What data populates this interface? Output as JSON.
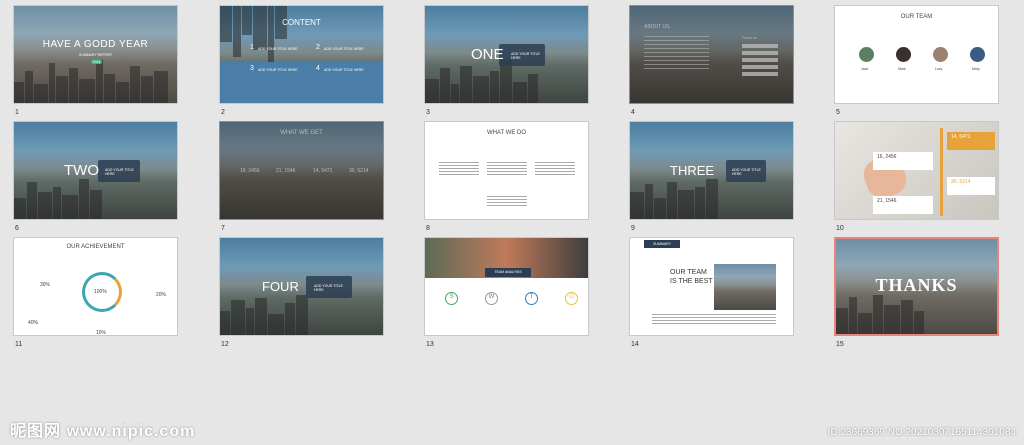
{
  "slides": [
    {
      "num": "1",
      "title": "HAVE A GODD YEAR",
      "subtitle": "SUMMARY REPORT",
      "badge": "2021"
    },
    {
      "num": "2",
      "title": "CONTENT",
      "items": [
        {
          "n": "1",
          "label": "ADD YOUR TITLE HERE"
        },
        {
          "n": "2",
          "label": "ADD YOUR TITLE HERE"
        },
        {
          "n": "3",
          "label": "ADD YOUR TITLE HERE"
        },
        {
          "n": "4",
          "label": "ADD YOUR TITLE HERE"
        }
      ]
    },
    {
      "num": "3",
      "big": "ONE",
      "side": "ADD YOUR TITLE HERE"
    },
    {
      "num": "4",
      "title": "ABOUT US",
      "follow": "Follow us"
    },
    {
      "num": "5",
      "title": "OUR TEAM",
      "members": [
        "Jack",
        "Mark",
        "Lucy",
        "Mary"
      ]
    },
    {
      "num": "6",
      "big": "TWO",
      "side": "ADD YOUR TITLE HERE"
    },
    {
      "num": "7",
      "title": "WHAT WE GET",
      "stats": [
        "18, 2456",
        "21, 1546",
        "14, 5471",
        "30, 5214"
      ]
    },
    {
      "num": "8",
      "title": "WHAT WE DO"
    },
    {
      "num": "9",
      "big": "THREE",
      "side": "ADD YOUR TITLE HERE"
    },
    {
      "num": "10",
      "stats": [
        "16, 2456",
        "14, 5471",
        "30, 5214",
        "21, 1546"
      ]
    },
    {
      "num": "11",
      "title": "OUR ACHIEVEMENT",
      "center": "100%",
      "p1": "30%",
      "p2": "20%",
      "p3": "40%",
      "p4": "10%"
    },
    {
      "num": "12",
      "big": "FOUR",
      "side": "ADD YOUR TITLE HERE"
    },
    {
      "num": "13",
      "title": "TEAM ANALYSIS",
      "letters": [
        "S",
        "W",
        "T",
        "O"
      ]
    },
    {
      "num": "14",
      "tag": "SUMMARY",
      "head1": "OUR TEAM",
      "head2": "IS THE BEST"
    },
    {
      "num": "15",
      "big": "THANKS"
    }
  ],
  "watermark_left": "昵图网 www.nipic.com",
  "watermark_right": "ID:23669369 NO:20210307165114301084",
  "colors": {
    "accent": "#e8857a",
    "navy": "#2b3e52",
    "orange": "#e8a23a"
  }
}
